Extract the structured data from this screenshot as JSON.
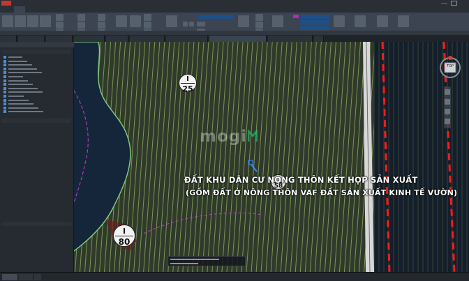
{
  "overlay": {
    "line1": "ĐẤT KHU DÂN CƯ NÔNG THÔN KẾT HỢP SẢN XUẤT",
    "line2": "(GỒM ĐẤT Ở NÔNG THÔN VAF ĐẤT SẢN XUẤT KINH TẾ VƯỜN)"
  },
  "watermark": {
    "logo_text": "mogi"
  },
  "parcels": [
    {
      "id": "I",
      "number": "25"
    },
    {
      "id": "I",
      "number": "80"
    },
    {
      "id": "",
      "number": "58"
    }
  ],
  "viewcube": {
    "face": "TOP"
  },
  "colors": {
    "app_red": "#c8362f",
    "ribbon_bg": "#3b4450",
    "dashed_boundary": "#ff1a1a",
    "road": "#d7d7d7",
    "hatch": "#9fb96a",
    "drainage": "#c43fd0"
  }
}
